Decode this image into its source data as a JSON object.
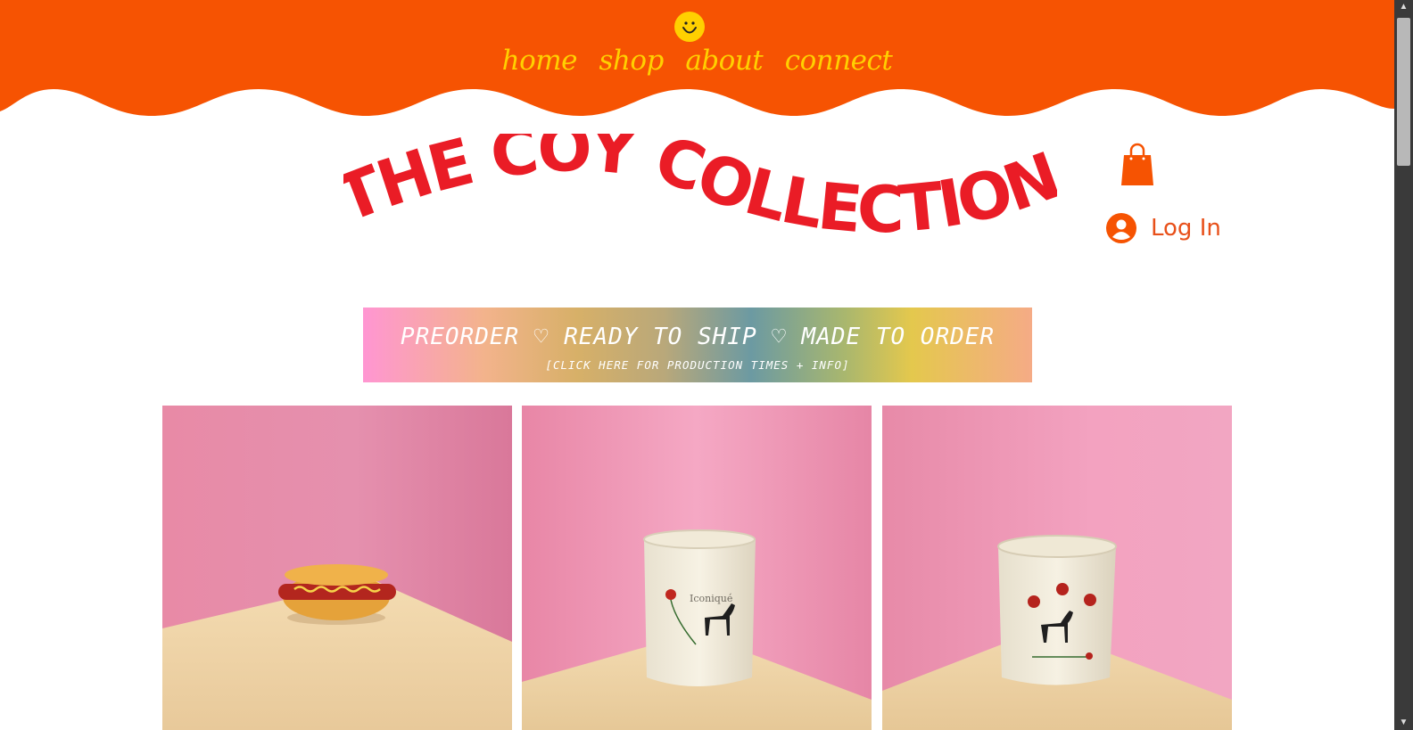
{
  "nav": {
    "items": [
      {
        "label": "home"
      },
      {
        "label": "shop"
      },
      {
        "label": "about"
      },
      {
        "label": "connect"
      }
    ]
  },
  "brand": {
    "title": "THE COY COLLECTION"
  },
  "account": {
    "login_label": "Log In"
  },
  "banner": {
    "main_text": "PREORDER ♡ READY TO SHIP ♡ MADE TO ORDER",
    "sub_text": "[CLICK HERE FOR PRODUCTION TIMES + INFO]"
  },
  "products": [
    {
      "image": "hot-dog-sculpture"
    },
    {
      "image": "horse-cup-iconique",
      "cup_text": "Iconiqué"
    },
    {
      "image": "horse-cup-roses"
    }
  ],
  "colors": {
    "header_orange": "#f65302",
    "nav_yellow": "#ffd000",
    "brand_red": "#ea1c26",
    "accent_orange": "#f65302"
  },
  "icons": [
    "smiley-icon",
    "shopping-bag-icon",
    "user-avatar-icon"
  ]
}
